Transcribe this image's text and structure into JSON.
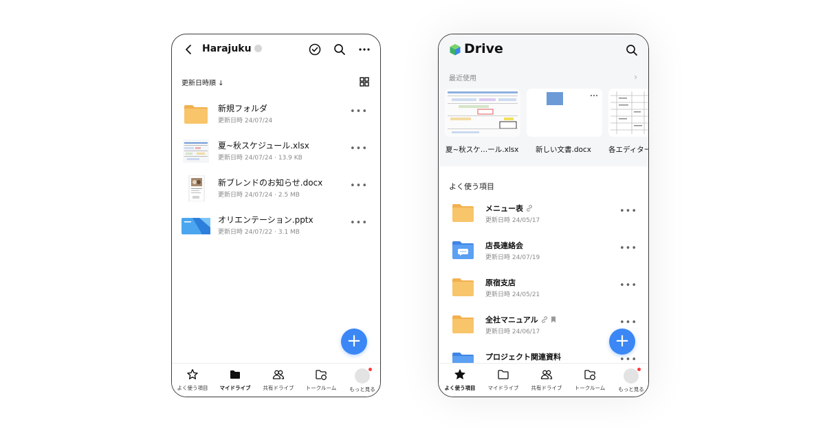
{
  "phone1": {
    "header": {
      "title": "Harajuku"
    },
    "sort_label": "更新日時順 ↓",
    "files": [
      {
        "name": "新規フォルダ",
        "meta": "更新日時 24/07/24",
        "icon": "folder-icon"
      },
      {
        "name": "夏~秋スケジュール.xlsx",
        "meta": "更新日時 24/07/24 · 13.9 KB",
        "icon": "spreadsheet-thumbnail"
      },
      {
        "name": "新ブレンドのお知らせ.docx",
        "meta": "更新日時 24/07/24 · 2.5 MB",
        "icon": "document-thumbnail"
      },
      {
        "name": "オリエンテーション.pptx",
        "meta": "更新日時 24/07/22 · 3.1 MB",
        "icon": "presentation-thumbnail"
      }
    ],
    "fab_label": "+",
    "tabs": [
      {
        "label": "よく使う項目",
        "icon": "star-icon"
      },
      {
        "label": "マイドライブ",
        "icon": "folder-filled-icon",
        "active": true
      },
      {
        "label": "共有ドライブ",
        "icon": "people-icon"
      },
      {
        "label": "トークルーム",
        "icon": "talk-folder-icon"
      },
      {
        "label": "もっと見る",
        "icon": "avatar"
      }
    ]
  },
  "phone2": {
    "header": {
      "title": "Drive"
    },
    "recent_label": "最近使用",
    "recent": [
      {
        "name": "夏~秋スケ…ール.xlsx"
      },
      {
        "name": "新しい文書.docx"
      },
      {
        "name": "各エディター"
      }
    ],
    "section_label": "よく使う項目",
    "favorites": [
      {
        "name": "メニュー表",
        "meta": "更新日時 24/05/17",
        "icon": "folder-icon",
        "link": true
      },
      {
        "name": "店長連絡会",
        "meta": "更新日時 24/07/19",
        "icon": "talk-folder-icon"
      },
      {
        "name": "原宿支店",
        "meta": "更新日時 24/05/21",
        "icon": "folder-icon"
      },
      {
        "name": "全社マニュアル",
        "meta": "更新日時 24/06/17",
        "icon": "folder-icon",
        "link": true,
        "bookmark": true
      },
      {
        "name": "プロジェクト関連資料",
        "meta": "",
        "icon": "shared-folder-icon"
      }
    ],
    "fab_label": "+",
    "tabs": [
      {
        "label": "よく使う項目",
        "icon": "star-filled-icon",
        "active": true
      },
      {
        "label": "マイドライブ",
        "icon": "folder-outline-icon"
      },
      {
        "label": "共有ドライブ",
        "icon": "people-icon"
      },
      {
        "label": "トークルーム",
        "icon": "talk-folder-icon"
      },
      {
        "label": "もっと見る",
        "icon": "avatar"
      }
    ]
  },
  "colors": {
    "accent": "#3b87f5",
    "folder": "#f8c56b",
    "folder_blue": "#5ba0f2",
    "notification": "#ff3b3b"
  }
}
